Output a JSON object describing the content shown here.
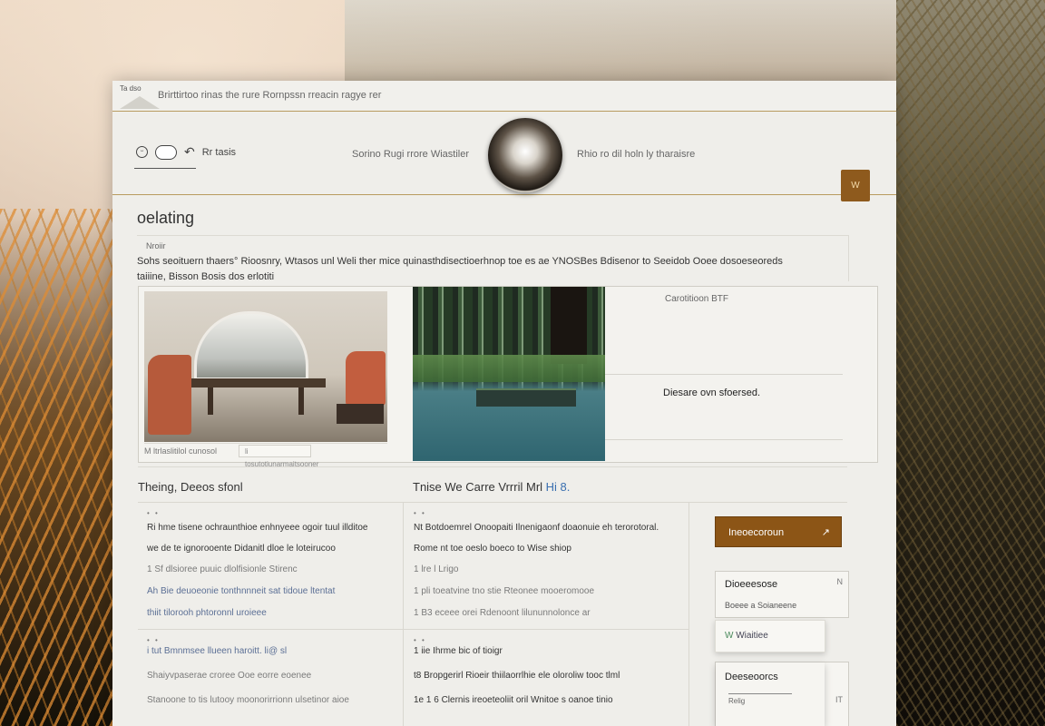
{
  "topbar": {
    "logo_text": "Ta dso",
    "crumb": "Brirttirtoo rinas the rure Rornpssn rreacin ragye rer"
  },
  "header": {
    "icons": [
      "smiley-icon",
      "toggle-icon",
      "undo-icon"
    ],
    "user_label": "Rr tasis",
    "mid_left": "Sorino Rugi rrore Wiastiler",
    "mid_right": "Rhio ro dil holn ly tharaisre",
    "action_label": "W"
  },
  "section": {
    "title": "oelating",
    "intro_small": "Nroiir",
    "intro_text": "Sohs seoituern thaers° Rioosnry, Wtasos unl Weli ther mice quinasthdisectioerhnop toe es ae YNOSBes Bdisenor to Seeidob Ooee dosoeseoreds taiiine, Bisson Bosis dos erlotiti"
  },
  "gallery": {
    "caption": "M ltrlaslitilol  cunosol",
    "caption_chip": "li tosutotiunarmaitsooner",
    "side_small": "Carotitioon BTF",
    "side_text": "Diesare ovn sfoersed."
  },
  "table": {
    "headings": {
      "col1": "Theing, Deeos sfonl",
      "col2_a": "Tnise  We Carre  ",
      "col2_b": "Vrrril",
      "col2_c": "Mrl",
      "col2_accent": "Hi  8."
    },
    "col1_rows": [
      {
        "mark": "• •",
        "lines": [
          "Ri hme tisene ochraunthioe enhnyeee ogoir tuul illditoe",
          "we de te ignorooente Didanitl dloe le loteirucoo",
          "1 Sf dlsioree puuic dlolfisionle Stirenc",
          "Ah Bie deuoeonie tonthnnneit sat tidoue ltentat",
          "thiit tilorooh phtoronnl uroieee"
        ]
      },
      {
        "mark": "• •",
        "lines": [
          "i tut Bmnmsee llueen haroitt. li@ sl",
          "Shaiyvpaserae croree Ooe eorre eoenee",
          "Stanoone to tis lutooy moonorirrionn ulsetinor aioe"
        ]
      }
    ],
    "col2_rows": [
      {
        "mark": "• •",
        "lines": [
          "Nt Botdoemrel Onoopaiti Ilnenigaonf doaonuie eh terorotoral.",
          "Rome nt toe oeslo boeco to Wise shiop",
          "1 lre l Lrigo",
          "1 pli toeatvine tno stie Rteonee mooeromooe",
          "1 B3  eceee orei Rdenoont lilununnolonce ar"
        ]
      },
      {
        "mark": "• •",
        "lines": [
          "1 iie Ihrme bic of tioigr",
          "t8  Bropgerirl Rioeir thiilaorrlhie ele oloroliw tooc tlml",
          "1e 1 6 Clernis ireoeteoliit oril Wnitoe s oanoe tinio"
        ]
      }
    ],
    "cta_label": "Ineoecoroun",
    "cta_arrow": "↗",
    "card1_title": "Dioeeesose",
    "card1_sub": "Boeee a Soianeene",
    "card1_corner": "N",
    "chip_mark": "W",
    "chip_label": "Wiaitiee",
    "card2_title": "Deeseoorcs",
    "card2_sub": "Relig",
    "card2_corner": "IT"
  }
}
